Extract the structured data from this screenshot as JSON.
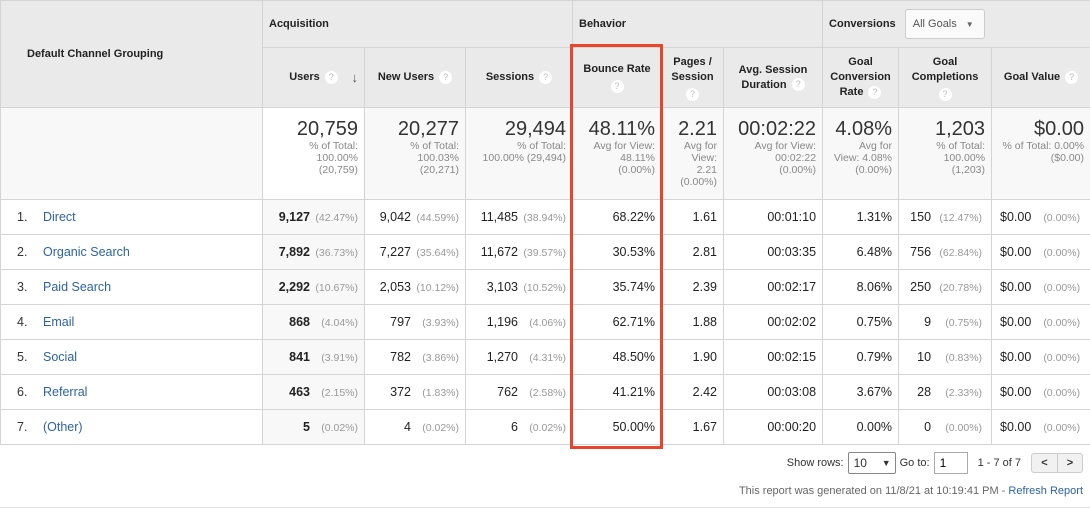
{
  "header": {
    "dimension": "Default Channel Grouping",
    "groups": {
      "acquisition": "Acquisition",
      "behavior": "Behavior",
      "conversions": "Conversions"
    },
    "goals_select": "All Goals",
    "columns": {
      "users": "Users",
      "new_users": "New Users",
      "sessions": "Sessions",
      "bounce_rate": "Bounce Rate",
      "pages_session_1": "Pages /",
      "pages_session_2": "Session",
      "avg_dur_1": "Avg. Session",
      "avg_dur_2": "Duration",
      "gcr_1": "Goal",
      "gcr_2": "Conversion",
      "gcr_3": "Rate",
      "gc_1": "Goal",
      "gc_2": "Completions",
      "goal_value": "Goal Value"
    },
    "help_glyph": "?",
    "sort_glyph": "↓"
  },
  "totals": {
    "users": {
      "value": "20,759",
      "l1": "% of Total:",
      "l2": "100.00%",
      "l3": "(20,759)"
    },
    "new_users": {
      "value": "20,277",
      "l1": "% of Total:",
      "l2": "100.03%",
      "l3": "(20,271)"
    },
    "sessions": {
      "value": "29,494",
      "l1": "% of Total:",
      "l2": "100.00% (29,494)"
    },
    "bounce_rate": {
      "value": "48.11%",
      "l1": "Avg for View:",
      "l2": "48.11%",
      "l3": "(0.00%)"
    },
    "pages_session": {
      "value": "2.21",
      "l1": "Avg for",
      "l2": "View:",
      "l3": "2.21",
      "l4": "(0.00%)"
    },
    "avg_duration": {
      "value": "00:02:22",
      "l1": "Avg for View:",
      "l2": "00:02:22",
      "l3": "(0.00%)"
    },
    "goal_conv_rate": {
      "value": "4.08%",
      "l1": "Avg for",
      "l2": "View: 4.08%",
      "l3": "(0.00%)"
    },
    "goal_completions": {
      "value": "1,203",
      "l1": "% of Total:",
      "l2": "100.00%",
      "l3": "(1,203)"
    },
    "goal_value": {
      "value": "$0.00",
      "l1": "% of Total: 0.00%",
      "l2": "($0.00)"
    }
  },
  "rows": [
    {
      "idx": "1.",
      "channel": "Direct",
      "users": "9,127",
      "users_pct": "(42.47%)",
      "new_users": "9,042",
      "new_users_pct": "(44.59%)",
      "sessions": "11,485",
      "sessions_pct": "(38.94%)",
      "bounce_rate": "68.22%",
      "pages_session": "1.61",
      "avg_duration": "00:01:10",
      "goal_conv_rate": "1.31%",
      "goal_completions": "150",
      "goal_completions_pct": "(12.47%)",
      "goal_value": "$0.00",
      "goal_value_pct": "(0.00%)"
    },
    {
      "idx": "2.",
      "channel": "Organic Search",
      "users": "7,892",
      "users_pct": "(36.73%)",
      "new_users": "7,227",
      "new_users_pct": "(35.64%)",
      "sessions": "11,672",
      "sessions_pct": "(39.57%)",
      "bounce_rate": "30.53%",
      "pages_session": "2.81",
      "avg_duration": "00:03:35",
      "goal_conv_rate": "6.48%",
      "goal_completions": "756",
      "goal_completions_pct": "(62.84%)",
      "goal_value": "$0.00",
      "goal_value_pct": "(0.00%)"
    },
    {
      "idx": "3.",
      "channel": "Paid Search",
      "users": "2,292",
      "users_pct": "(10.67%)",
      "new_users": "2,053",
      "new_users_pct": "(10.12%)",
      "sessions": "3,103",
      "sessions_pct": "(10.52%)",
      "bounce_rate": "35.74%",
      "pages_session": "2.39",
      "avg_duration": "00:02:17",
      "goal_conv_rate": "8.06%",
      "goal_completions": "250",
      "goal_completions_pct": "(20.78%)",
      "goal_value": "$0.00",
      "goal_value_pct": "(0.00%)"
    },
    {
      "idx": "4.",
      "channel": "Email",
      "users": "868",
      "users_pct": "(4.04%)",
      "new_users": "797",
      "new_users_pct": "(3.93%)",
      "sessions": "1,196",
      "sessions_pct": "(4.06%)",
      "bounce_rate": "62.71%",
      "pages_session": "1.88",
      "avg_duration": "00:02:02",
      "goal_conv_rate": "0.75%",
      "goal_completions": "9",
      "goal_completions_pct": "(0.75%)",
      "goal_value": "$0.00",
      "goal_value_pct": "(0.00%)"
    },
    {
      "idx": "5.",
      "channel": "Social",
      "users": "841",
      "users_pct": "(3.91%)",
      "new_users": "782",
      "new_users_pct": "(3.86%)",
      "sessions": "1,270",
      "sessions_pct": "(4.31%)",
      "bounce_rate": "48.50%",
      "pages_session": "1.90",
      "avg_duration": "00:02:15",
      "goal_conv_rate": "0.79%",
      "goal_completions": "10",
      "goal_completions_pct": "(0.83%)",
      "goal_value": "$0.00",
      "goal_value_pct": "(0.00%)"
    },
    {
      "idx": "6.",
      "channel": "Referral",
      "users": "463",
      "users_pct": "(2.15%)",
      "new_users": "372",
      "new_users_pct": "(1.83%)",
      "sessions": "762",
      "sessions_pct": "(2.58%)",
      "bounce_rate": "41.21%",
      "pages_session": "2.42",
      "avg_duration": "00:03:08",
      "goal_conv_rate": "3.67%",
      "goal_completions": "28",
      "goal_completions_pct": "(2.33%)",
      "goal_value": "$0.00",
      "goal_value_pct": "(0.00%)"
    },
    {
      "idx": "7.",
      "channel": "(Other)",
      "users": "5",
      "users_pct": "(0.02%)",
      "new_users": "4",
      "new_users_pct": "(0.02%)",
      "sessions": "6",
      "sessions_pct": "(0.02%)",
      "bounce_rate": "50.00%",
      "pages_session": "1.67",
      "avg_duration": "00:00:20",
      "goal_conv_rate": "0.00%",
      "goal_completions": "0",
      "goal_completions_pct": "(0.00%)",
      "goal_value": "$0.00",
      "goal_value_pct": "(0.00%)"
    }
  ],
  "footer": {
    "show_rows_label": "Show rows:",
    "show_rows_value": "10",
    "goto_label": "Go to:",
    "goto_value": "1",
    "range": "1 - 7 of 7",
    "prev_glyph": "<",
    "next_glyph": ">",
    "generated": "This report was generated on 11/8/21 at 10:19:41 PM - ",
    "refresh": "Refresh Report"
  },
  "colors": {
    "highlight": "#e8452c",
    "link": "#2c63a5",
    "header_bg": "#eaeaea"
  }
}
